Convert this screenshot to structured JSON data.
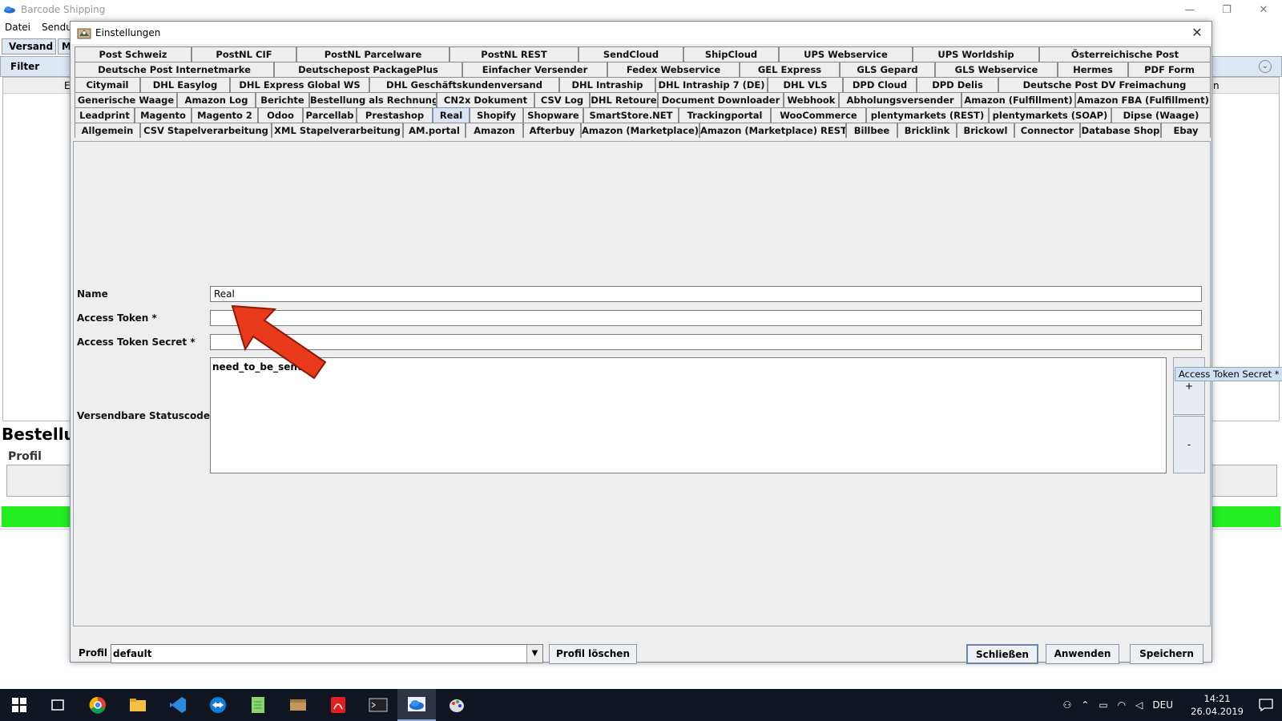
{
  "background_app": {
    "title": "Barcode Shipping",
    "menu": [
      "Datei",
      "Sendu"
    ],
    "tabs": [
      "Versand",
      "M"
    ],
    "filter_label": "Filter",
    "table_header_fragments": [
      "E",
      "n"
    ],
    "section_title": "Bestellu",
    "profil_label": "Profil",
    "window_controls": [
      "—",
      "❐",
      "✕"
    ]
  },
  "dialog": {
    "title": "Einstellungen",
    "close_label": "✕",
    "tab_rows": [
      [
        "Post Schweiz",
        "PostNL CIF",
        "PostNL Parcelware",
        "PostNL REST",
        "SendCloud",
        "ShipCloud",
        "UPS Webservice",
        "UPS Worldship",
        "Österreichische Post"
      ],
      [
        "Deutsche Post Internetmarke",
        "Deutschepost PackagePlus",
        "Einfacher Versender",
        "Fedex Webservice",
        "GEL Express",
        "GLS Gepard",
        "GLS Webservice",
        "Hermes",
        "PDF Form"
      ],
      [
        "Citymail",
        "DHL Easylog",
        "DHL Express Global WS",
        "DHL Geschäftskundenversand",
        "DHL Intraship",
        "DHL Intraship 7 (DE)",
        "DHL VLS",
        "DPD Cloud",
        "DPD Delis",
        "Deutsche Post DV Freimachung"
      ],
      [
        "Generische Waage",
        "Amazon Log",
        "Berichte",
        "Bestellung als Rechnung",
        "CN2x Dokument",
        "CSV Log",
        "DHL Retoure",
        "Document Downloader",
        "Webhook",
        "Abholungsversender",
        "Amazon (Fulfillment)",
        "Amazon FBA (Fulfillment)"
      ],
      [
        "Leadprint",
        "Magento",
        "Magento 2",
        "Odoo",
        "Parcellab",
        "Prestashop",
        "Real",
        "Shopify",
        "Shopware",
        "SmartStore.NET",
        "Trackingportal",
        "WooCommerce",
        "plentymarkets (REST)",
        "plentymarkets (SOAP)",
        "Dipse (Waage)"
      ],
      [
        "Allgemein",
        "CSV Stapelverarbeitung",
        "XML Stapelverarbeitung",
        "AM.portal",
        "Amazon",
        "Afterbuy",
        "Amazon (Marketplace)",
        "Amazon (Marketplace) REST",
        "Billbee",
        "Bricklink",
        "Brickowl",
        "Connector",
        "Database Shop",
        "Ebay"
      ]
    ],
    "active_tab": "Real",
    "form": {
      "name_label": "Name",
      "name_value": "Real",
      "access_token_label": "Access Token *",
      "access_token_value": "",
      "access_token_secret_label": "Access Token Secret *",
      "access_token_secret_value": "",
      "statuscodes_label": "Versendbare Statuscodes *",
      "statuscodes_value": "need_to_be_sent",
      "add_label": "+",
      "remove_label": "-",
      "tooltip": "Access Token Secret *"
    },
    "bottom": {
      "profil_label": "Profil",
      "profil_value": "default",
      "delete_profile": "Profil löschen",
      "close": "Schließen",
      "apply": "Anwenden",
      "save": "Speichern"
    }
  },
  "taskbar": {
    "apps": [
      "start",
      "task-view",
      "chrome",
      "file-explorer",
      "vscode",
      "teamviewer",
      "notepad",
      "package",
      "acrobat",
      "terminal",
      "barcode-shipping",
      "paint"
    ],
    "tray_language": "DEU",
    "time": "14:21",
    "date": "26.04.2019"
  },
  "colors": {
    "accent_red": "#e8391a",
    "status_green": "#22ee22",
    "active_tab": "#dbe5f2",
    "taskbar": "#101522"
  }
}
